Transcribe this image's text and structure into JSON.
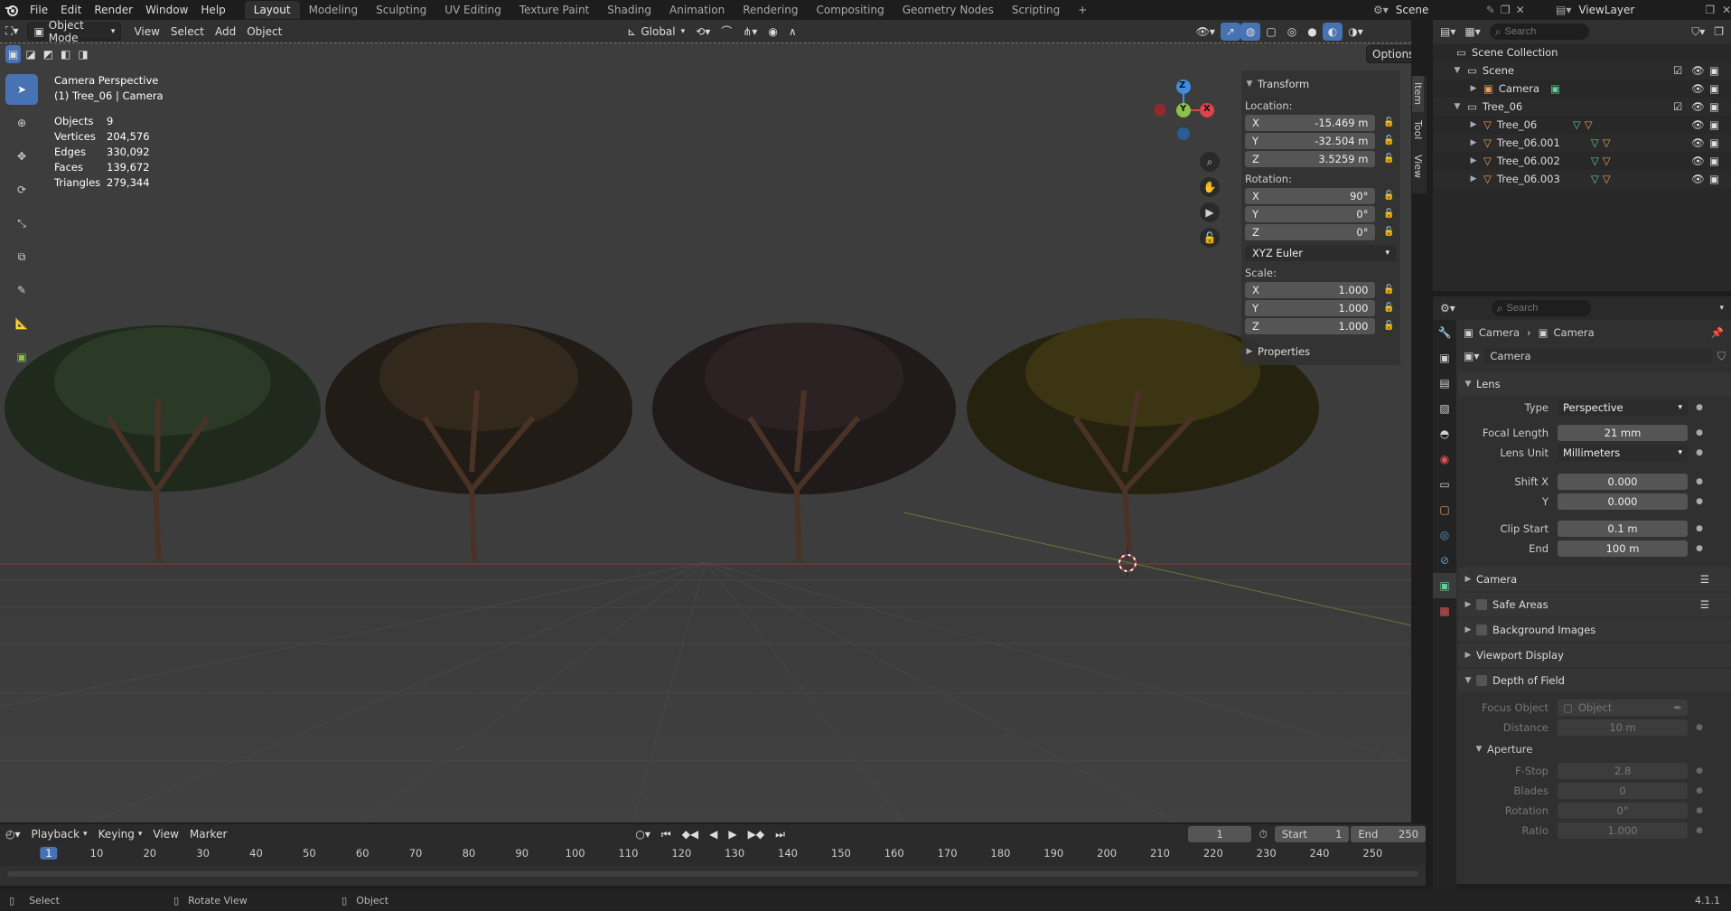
{
  "menu": [
    "File",
    "Edit",
    "Render",
    "Window",
    "Help"
  ],
  "workspaces": [
    "Layout",
    "Modeling",
    "Sculpting",
    "UV Editing",
    "Texture Paint",
    "Shading",
    "Animation",
    "Rendering",
    "Compositing",
    "Geometry Nodes",
    "Scripting"
  ],
  "add_tab": "+",
  "scene_name": "Scene",
  "view_layer": "ViewLayer",
  "viewport": {
    "mode": "Object Mode",
    "menus": [
      "View",
      "Select",
      "Add",
      "Object"
    ],
    "orientation": "Global",
    "options": "Options",
    "title": "Camera Perspective",
    "subtitle": "(1) Tree_06 | Camera",
    "stats": [
      {
        "label": "Objects",
        "value": "9"
      },
      {
        "label": "Vertices",
        "value": "204,576"
      },
      {
        "label": "Edges",
        "value": "330,092"
      },
      {
        "label": "Faces",
        "value": "139,672"
      },
      {
        "label": "Triangles",
        "value": "279,344"
      }
    ],
    "gizmo": {
      "z": "Z",
      "y": "Y",
      "x": "X"
    }
  },
  "npanel": {
    "header": "Transform",
    "location_label": "Location:",
    "location": [
      {
        "axis": "X",
        "value": "-15.469 m"
      },
      {
        "axis": "Y",
        "value": "-32.504 m"
      },
      {
        "axis": "Z",
        "value": "3.5259 m"
      }
    ],
    "rotation_label": "Rotation:",
    "rotation": [
      {
        "axis": "X",
        "value": "90°"
      },
      {
        "axis": "Y",
        "value": "0°"
      },
      {
        "axis": "Z",
        "value": "0°"
      }
    ],
    "rotation_mode": "XYZ Euler",
    "scale_label": "Scale:",
    "scale": [
      {
        "axis": "X",
        "value": "1.000"
      },
      {
        "axis": "Y",
        "value": "1.000"
      },
      {
        "axis": "Z",
        "value": "1.000"
      }
    ],
    "properties": "Properties",
    "tabs": [
      "Item",
      "Tool",
      "View"
    ]
  },
  "outliner": {
    "search_placeholder": "Search",
    "collection": "Scene Collection",
    "items": [
      {
        "name": "Scene",
        "depth": 1
      },
      {
        "name": "Camera",
        "depth": 2
      },
      {
        "name": "Tree_06",
        "depth": 1
      },
      {
        "name": "Tree_06",
        "depth": 2
      },
      {
        "name": "Tree_06.001",
        "depth": 2
      },
      {
        "name": "Tree_06.002",
        "depth": 2
      },
      {
        "name": "Tree_06.003",
        "depth": 2
      }
    ]
  },
  "properties": {
    "search_placeholder": "Search",
    "breadcrumb": [
      "Camera",
      "Camera"
    ],
    "datablock": "Camera",
    "lens_section": "Lens",
    "type_label": "Type",
    "type_value": "Perspective",
    "focal_label": "Focal Length",
    "focal_value": "21 mm",
    "lensunit_label": "Lens Unit",
    "lensunit_value": "Millimeters",
    "shiftx_label": "Shift X",
    "shiftx_value": "0.000",
    "shifty_label": "Y",
    "shifty_value": "0.000",
    "clipstart_label": "Clip Start",
    "clipstart_value": "0.1 m",
    "clipend_label": "End",
    "clipend_value": "100 m",
    "sections": [
      "Camera",
      "Safe Areas",
      "Background Images",
      "Viewport Display",
      "Depth of Field"
    ],
    "focus_label": "Focus Object",
    "focus_placeholder": "Object",
    "distance_label": "Distance",
    "distance_value": "10 m",
    "aperture_section": "Aperture",
    "fstop_label": "F-Stop",
    "fstop_value": "2.8",
    "blades_label": "Blades",
    "blades_value": "0",
    "rotation_label": "Rotation",
    "rotation_value": "0°",
    "ratio_label": "Ratio",
    "ratio_value": "1.000"
  },
  "timeline": {
    "menus": [
      "Playback",
      "Keying",
      "View",
      "Marker"
    ],
    "current_frame": "1",
    "start_label": "Start",
    "start_value": "1",
    "end_label": "End",
    "end_value": "250",
    "ticks": [
      "1",
      "10",
      "20",
      "30",
      "40",
      "50",
      "60",
      "70",
      "80",
      "90",
      "100",
      "110",
      "120",
      "130",
      "140",
      "150",
      "160",
      "170",
      "180",
      "190",
      "200",
      "210",
      "220",
      "230",
      "240",
      "250"
    ]
  },
  "status": {
    "select": "Select",
    "rotate": "Rotate View",
    "object": "Object",
    "version": "4.1.1"
  },
  "colors": {
    "accent": "#4772b3",
    "x_axis": "#e0424b",
    "y_axis": "#8bc34a",
    "z_axis": "#3d8ee0"
  }
}
